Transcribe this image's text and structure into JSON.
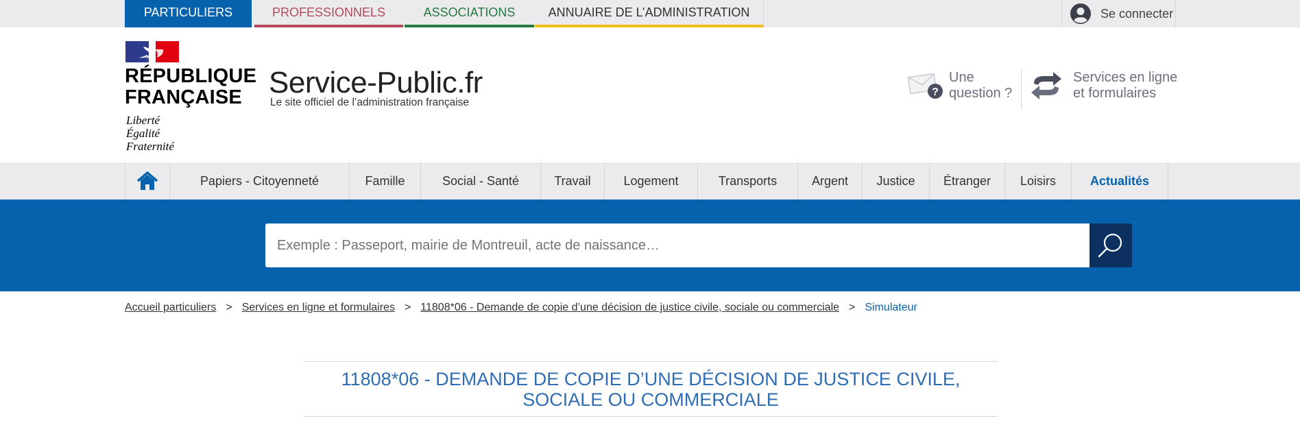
{
  "topbar": {
    "tabs": [
      {
        "label": "PARTICULIERS"
      },
      {
        "label": "PROFESSIONNELS"
      },
      {
        "label": "ASSOCIATIONS"
      },
      {
        "label": "ANNUAIRE DE L’ADMINISTRATION"
      }
    ],
    "login_label": "Se connecter"
  },
  "header": {
    "rf_line1": "RÉPUBLIQUE",
    "rf_line2": "FRANÇAISE",
    "motto": [
      "Liberté",
      "Égalité",
      "Fraternité"
    ],
    "site_name": "Service-Public",
    "site_tld": ".fr",
    "site_tagline": "Le site officiel de l’administration française",
    "question_label_1": "Une",
    "question_label_2": "question ?",
    "services_label_1": "Services en ligne",
    "services_label_2": "et formulaires"
  },
  "nav": {
    "items": [
      {
        "label": "Papiers - Citoyenneté"
      },
      {
        "label": "Famille"
      },
      {
        "label": "Social - Santé"
      },
      {
        "label": "Travail"
      },
      {
        "label": "Logement"
      },
      {
        "label": "Transports"
      },
      {
        "label": "Argent"
      },
      {
        "label": "Justice"
      },
      {
        "label": "Étranger"
      },
      {
        "label": "Loisirs"
      },
      {
        "label": "Actualités"
      }
    ]
  },
  "search": {
    "placeholder": "Exemple : Passeport, mairie de Montreuil, acte de naissance…",
    "value": ""
  },
  "breadcrumb": {
    "items": [
      {
        "label": "Accueil particuliers"
      },
      {
        "label": "Services en ligne et formulaires"
      },
      {
        "label": "11808*06 - Demande de copie d’une décision de justice civile, sociale ou commerciale"
      }
    ],
    "separator": ">",
    "current": "Simulateur"
  },
  "page": {
    "title": "11808*06 - DEMANDE DE COPIE D’UNE DÉCISION DE JUSTICE CIVILE, SOCIALE OU COMMERCIALE"
  },
  "colors": {
    "primary_blue": "#0762ae",
    "dark_blue": "#0c3160",
    "pro_red": "#b34a5a",
    "asso_green": "#247a3f",
    "admin_yellow": "#f0bd1b"
  },
  "icons": {
    "login": "user-avatar-icon",
    "question": "envelope-question-icon",
    "services": "arrows-exchange-icon",
    "home": "home-icon",
    "search": "magnifier-icon"
  }
}
